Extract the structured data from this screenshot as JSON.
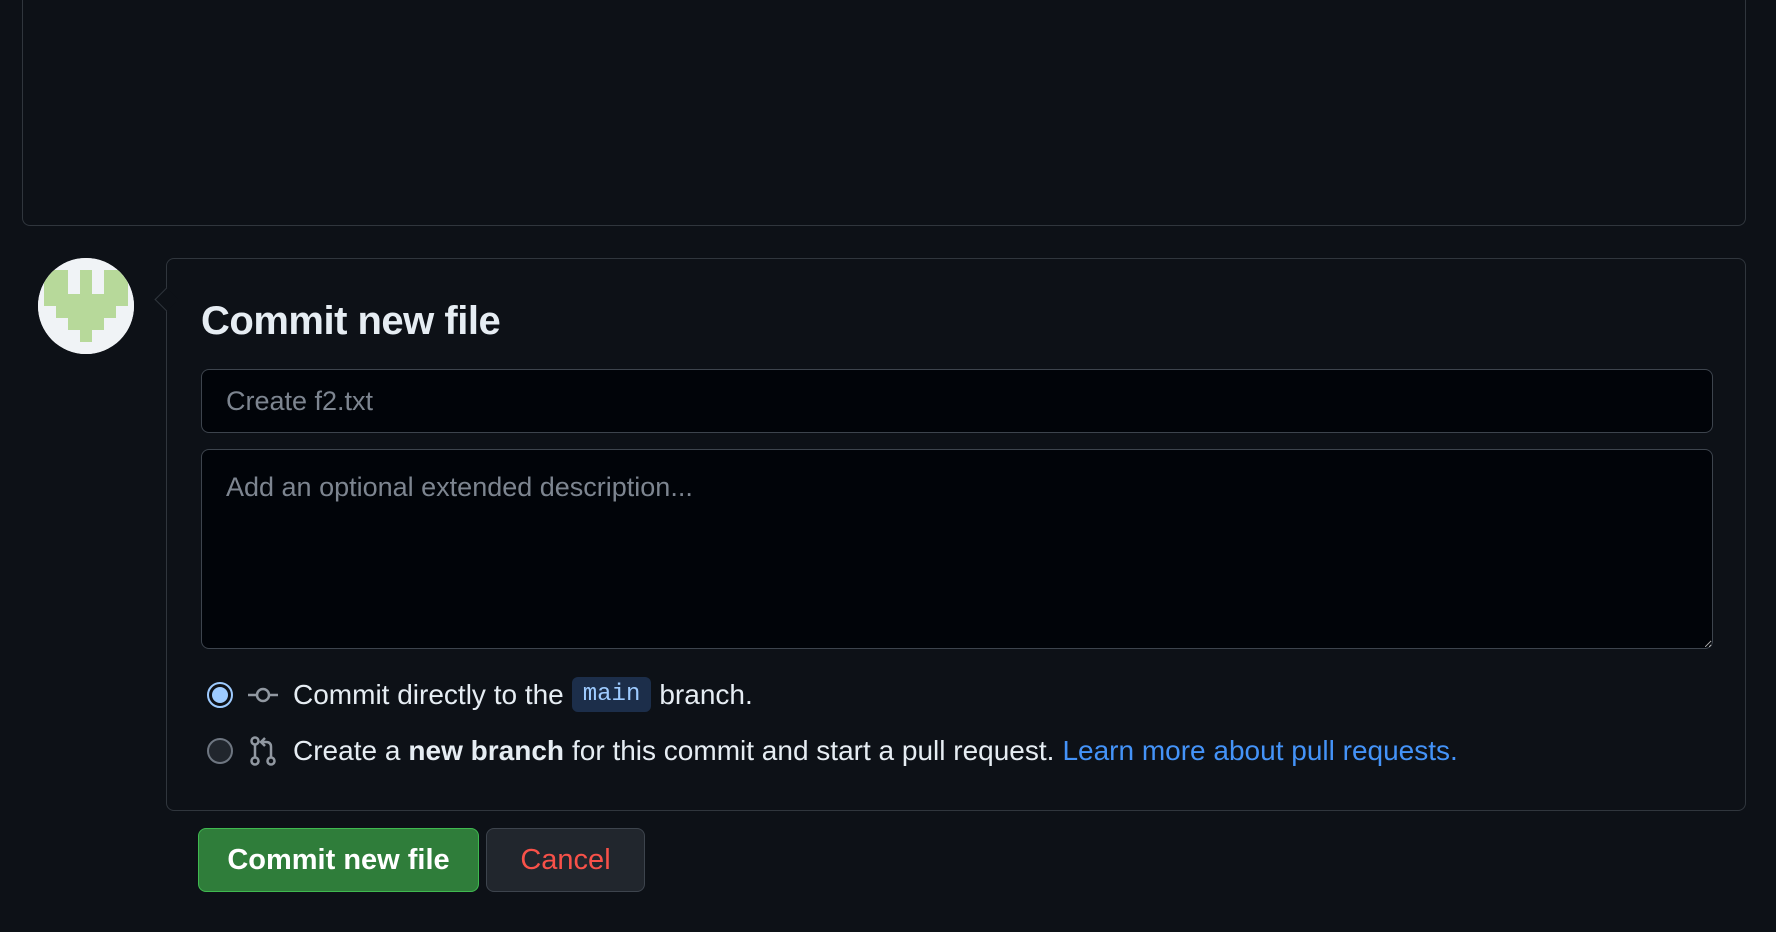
{
  "commit": {
    "title": "Commit new file",
    "summary_placeholder": "Create f2.txt",
    "description_placeholder": "Add an optional extended description...",
    "option_direct": {
      "prefix": "Commit directly to the",
      "branch": "main",
      "suffix": "branch.",
      "selected": true,
      "icon": "git-commit-icon"
    },
    "option_new_branch": {
      "prefix": "Create a",
      "bold": "new branch",
      "suffix": "for this commit and start a pull request.",
      "link": "Learn more about pull requests.",
      "selected": false,
      "icon": "git-pull-request-icon"
    },
    "submit_label": "Commit new file",
    "cancel_label": "Cancel"
  },
  "colors": {
    "background": "#0d1117",
    "accent_green": "#2f7d3a",
    "link_blue": "#4493f8",
    "danger_red": "#f85149",
    "avatar_green": "#b7d99a"
  }
}
